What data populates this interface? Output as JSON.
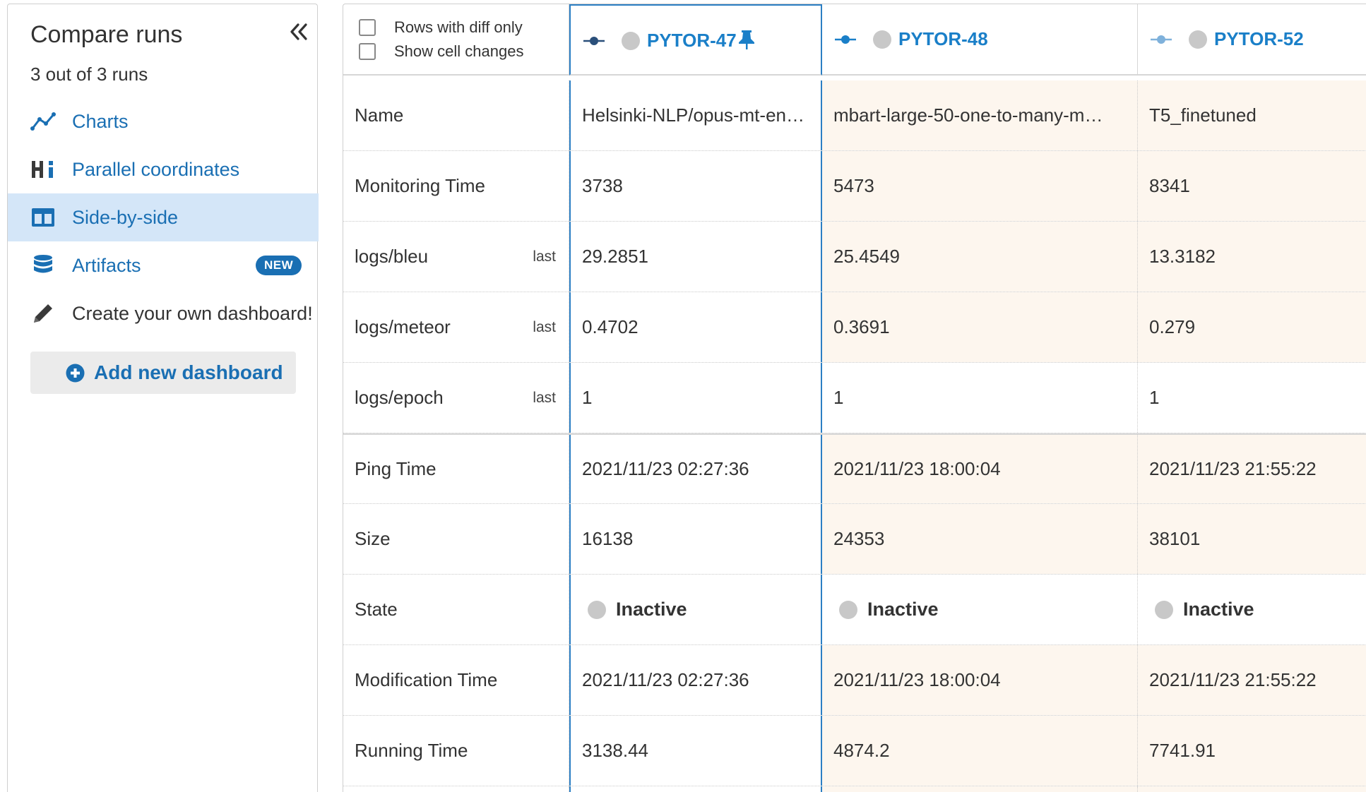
{
  "sidebar": {
    "title": "Compare runs",
    "run_count": "3 out of 3 runs",
    "collapse_icon": "double-chevron-left-icon",
    "items": [
      {
        "label": "Charts",
        "icon": "line-chart-icon",
        "active": false
      },
      {
        "label": "Parallel coordinates",
        "icon": "hiplot-icon",
        "active": false
      },
      {
        "label": "Side-by-side",
        "icon": "columns-icon",
        "active": true
      },
      {
        "label": "Artifacts",
        "icon": "database-icon",
        "badge": "NEW",
        "active": false
      },
      {
        "label": "Create your own dashboard!",
        "icon": "pencil-icon",
        "active": false
      }
    ],
    "add_button": "Add new dashboard"
  },
  "options": {
    "rows_with_diff_only": "Rows with diff only",
    "show_cell_changes": "Show cell changes"
  },
  "runs": [
    {
      "id": "PYTOR-47",
      "pinned": true
    },
    {
      "id": "PYTOR-48",
      "pinned": false
    },
    {
      "id": "PYTOR-52",
      "pinned": false
    }
  ],
  "rows": [
    {
      "label": "Name",
      "agg": "",
      "values": [
        "Helsinki-NLP/opus-mt-en…",
        "mbart-large-50-one-to-many-m…",
        "T5_finetuned"
      ]
    },
    {
      "label": "Monitoring Time",
      "agg": "",
      "values": [
        "3738",
        "5473",
        "8341"
      ]
    },
    {
      "label": "logs/bleu",
      "agg": "last",
      "values": [
        "29.2851",
        "25.4549",
        "13.3182"
      ]
    },
    {
      "label": "logs/meteor",
      "agg": "last",
      "values": [
        "0.4702",
        "0.3691",
        "0.279"
      ]
    },
    {
      "label": "logs/epoch",
      "agg": "last",
      "values": [
        "1",
        "1",
        "1"
      ]
    },
    {
      "label": "Ping Time",
      "agg": "",
      "values": [
        "2021/11/23 02:27:36",
        "2021/11/23 18:00:04",
        "2021/11/23 21:55:22"
      ]
    },
    {
      "label": "Size",
      "agg": "",
      "values": [
        "16138",
        "24353",
        "38101"
      ]
    },
    {
      "label": "State",
      "agg": "",
      "values": [
        "Inactive",
        "Inactive",
        "Inactive"
      ]
    },
    {
      "label": "Modification Time",
      "agg": "",
      "values": [
        "2021/11/23 02:27:36",
        "2021/11/23 18:00:04",
        "2021/11/23 21:55:22"
      ]
    },
    {
      "label": "Running Time",
      "agg": "",
      "values": [
        "3138.44",
        "4874.2",
        "7741.91"
      ]
    }
  ],
  "colors": {
    "accent": "#1a7fc8",
    "active_bg": "#d4e6f8",
    "diff_bg": "#fdf6ee",
    "selected_border": "#2c7fc4"
  }
}
